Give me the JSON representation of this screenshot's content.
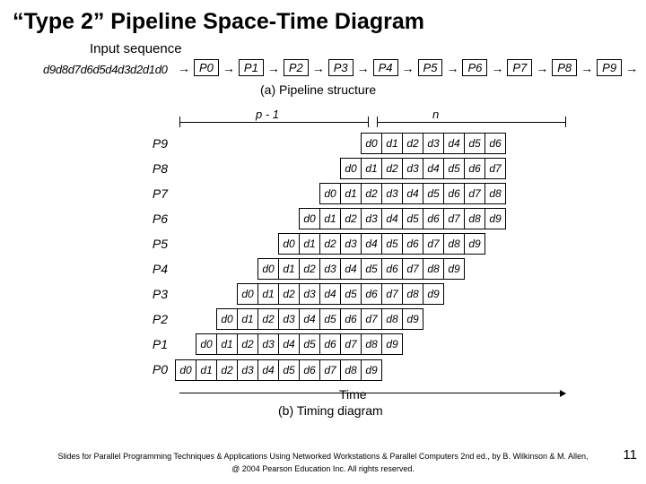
{
  "title": "“Type 2” Pipeline Space-Time Diagram",
  "inputSequence": {
    "label": "Input sequence",
    "items": [
      "d9",
      "d8",
      "d7",
      "d6",
      "d5",
      "d4",
      "d3",
      "d2",
      "d1",
      "d0"
    ]
  },
  "pipeline": {
    "stages": [
      "P0",
      "P1",
      "P2",
      "P3",
      "P4",
      "P5",
      "P6",
      "P7",
      "P8",
      "P9"
    ],
    "captionA": "(a) Pipeline structure",
    "captionB": "(b) Timing diagram"
  },
  "braces": {
    "left": "p - 1",
    "right": "n"
  },
  "timingRows": [
    {
      "label": "P9",
      "offset": 9,
      "cells": [
        "d0",
        "d1",
        "d2",
        "d3",
        "d4",
        "d5",
        "d6"
      ]
    },
    {
      "label": "P8",
      "offset": 8,
      "cells": [
        "d0",
        "d1",
        "d2",
        "d3",
        "d4",
        "d5",
        "d6",
        "d7"
      ]
    },
    {
      "label": "P7",
      "offset": 7,
      "cells": [
        "d0",
        "d1",
        "d2",
        "d3",
        "d4",
        "d5",
        "d6",
        "d7",
        "d8"
      ]
    },
    {
      "label": "P6",
      "offset": 6,
      "cells": [
        "d0",
        "d1",
        "d2",
        "d3",
        "d4",
        "d5",
        "d6",
        "d7",
        "d8",
        "d9"
      ]
    },
    {
      "label": "P5",
      "offset": 5,
      "cells": [
        "d0",
        "d1",
        "d2",
        "d3",
        "d4",
        "d5",
        "d6",
        "d7",
        "d8",
        "d9"
      ]
    },
    {
      "label": "P4",
      "offset": 4,
      "cells": [
        "d0",
        "d1",
        "d2",
        "d3",
        "d4",
        "d5",
        "d6",
        "d7",
        "d8",
        "d9"
      ]
    },
    {
      "label": "P3",
      "offset": 3,
      "cells": [
        "d0",
        "d1",
        "d2",
        "d3",
        "d4",
        "d5",
        "d6",
        "d7",
        "d8",
        "d9"
      ]
    },
    {
      "label": "P2",
      "offset": 2,
      "cells": [
        "d0",
        "d1",
        "d2",
        "d3",
        "d4",
        "d5",
        "d6",
        "d7",
        "d8",
        "d9"
      ]
    },
    {
      "label": "P1",
      "offset": 1,
      "cells": [
        "d0",
        "d1",
        "d2",
        "d3",
        "d4",
        "d5",
        "d6",
        "d7",
        "d8",
        "d9"
      ]
    },
    {
      "label": "P0",
      "offset": 0,
      "cells": [
        "d0",
        "d1",
        "d2",
        "d3",
        "d4",
        "d5",
        "d6",
        "d7",
        "d8",
        "d9"
      ]
    }
  ],
  "timeAxisLabel": "Time",
  "footerLine1": "Slides for Parallel Programming Techniques & Applications Using Networked Workstations & Parallel Computers 2nd ed., by B. Wilkinson & M. Allen,",
  "footerLine2": "@ 2004 Pearson Education Inc. All rights reserved.",
  "pageNumber": "11"
}
